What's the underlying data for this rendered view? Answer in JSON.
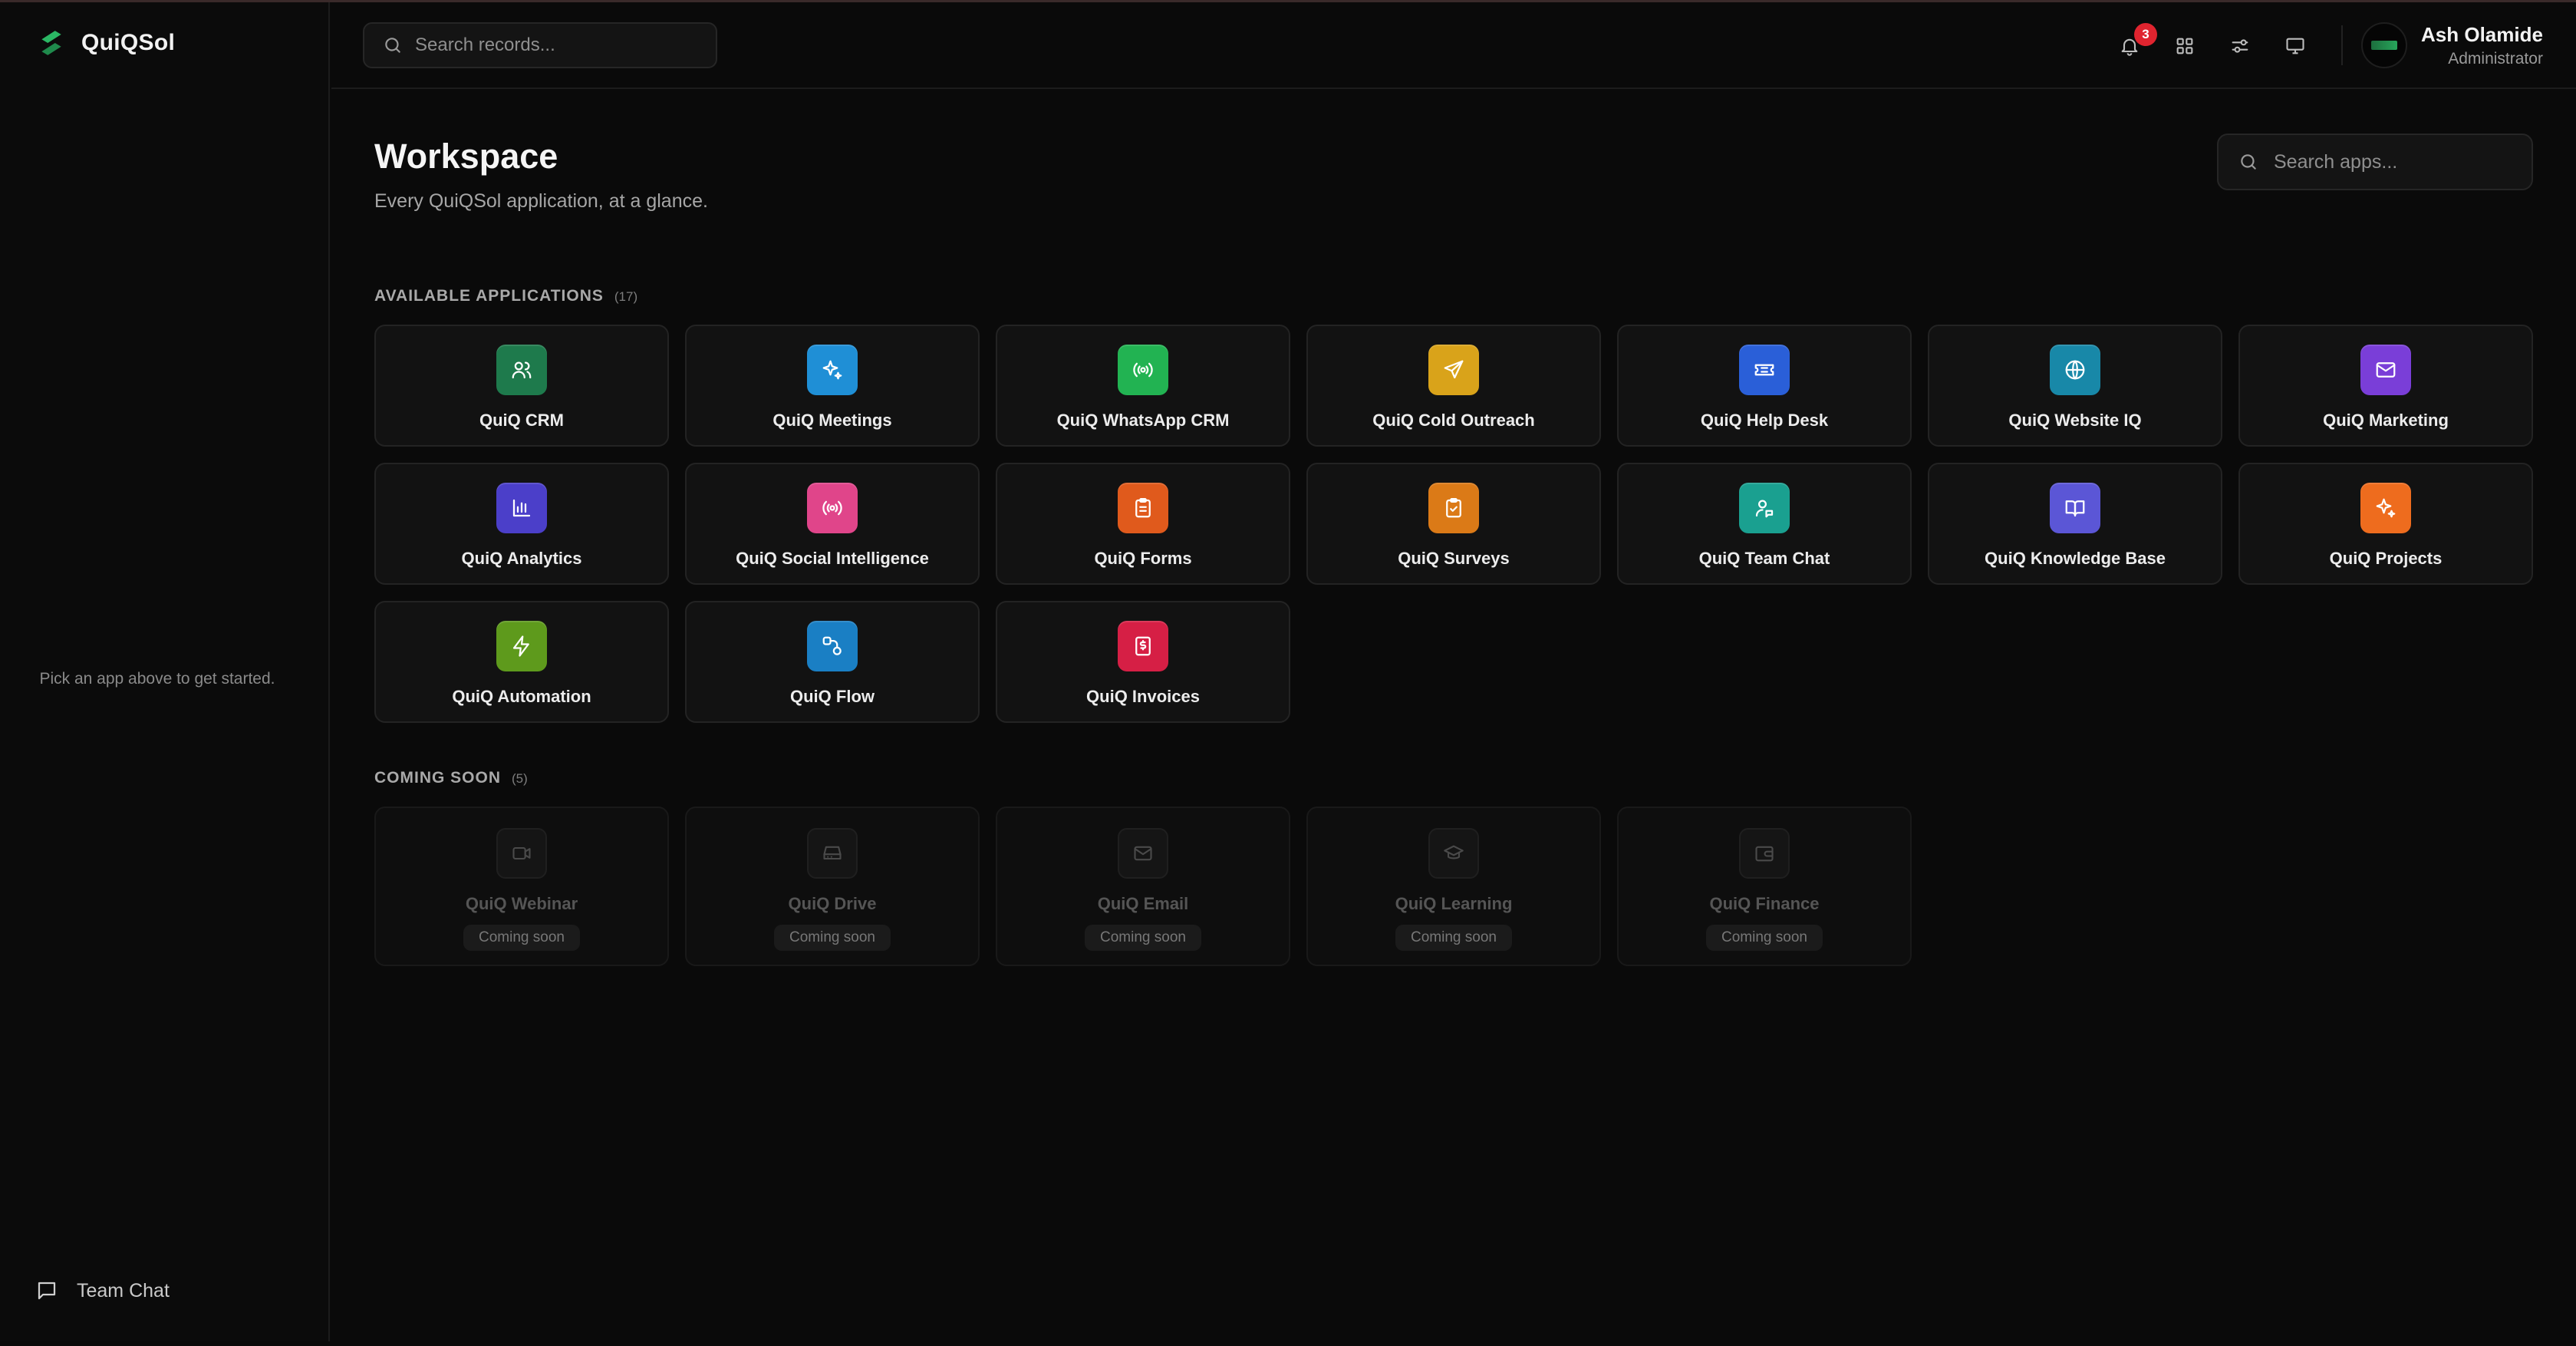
{
  "brand": {
    "name": "QuiQSol",
    "accent": "#2bb764"
  },
  "sidebar": {
    "hint": "Pick an app above to get started.",
    "footer_label": "Team Chat",
    "footer_icon": "message-square-icon"
  },
  "topbar": {
    "search_placeholder": "Search records...",
    "notifications_count": "3",
    "user_name": "Ash Olamide",
    "user_role": "Administrator"
  },
  "main": {
    "title": "Workspace",
    "subtitle": "Every QuiQSol application, at a glance.",
    "search_placeholder": "Search apps...",
    "available": {
      "title": "AVAILABLE APPLICATIONS",
      "count": "(17)",
      "apps": [
        {
          "label": "QuiQ CRM",
          "icon": "users-icon",
          "color": "#1e7a4c"
        },
        {
          "label": "QuiQ Meetings",
          "icon": "sparkles-icon",
          "color": "#1f8fd6"
        },
        {
          "label": "QuiQ WhatsApp CRM",
          "icon": "broadcast-icon",
          "color": "#22b352"
        },
        {
          "label": "QuiQ Cold Outreach",
          "icon": "send-icon",
          "color": "#d9a31a"
        },
        {
          "label": "QuiQ Help Desk",
          "icon": "ticket-icon",
          "color": "#2a5fd8"
        },
        {
          "label": "QuiQ Website IQ",
          "icon": "globe-icon",
          "color": "#1888a8"
        },
        {
          "label": "QuiQ Marketing",
          "icon": "mail-icon",
          "color": "#7a3ed8"
        },
        {
          "label": "QuiQ Analytics",
          "icon": "bar-chart-icon",
          "color": "#4b3fc9"
        },
        {
          "label": "QuiQ Social Intelligence",
          "icon": "broadcast-icon",
          "color": "#e0458a"
        },
        {
          "label": "QuiQ Forms",
          "icon": "clipboard-icon",
          "color": "#e05a1c"
        },
        {
          "label": "QuiQ Surveys",
          "icon": "clipboard-check-icon",
          "color": "#db7a17"
        },
        {
          "label": "QuiQ Team Chat",
          "icon": "user-chat-icon",
          "color": "#1aa090"
        },
        {
          "label": "QuiQ Knowledge Base",
          "icon": "book-icon",
          "color": "#5b56d6"
        },
        {
          "label": "QuiQ Projects",
          "icon": "sparkles-icon",
          "color": "#ee6c1e"
        },
        {
          "label": "QuiQ Automation",
          "icon": "zap-icon",
          "color": "#5e9a1c"
        },
        {
          "label": "QuiQ Flow",
          "icon": "workflow-icon",
          "color": "#1a7fc4"
        },
        {
          "label": "QuiQ Invoices",
          "icon": "invoice-icon",
          "color": "#d61f45"
        }
      ]
    },
    "coming_soon": {
      "title": "COMING SOON",
      "count": "(5)",
      "pill": "Coming soon",
      "apps": [
        {
          "label": "QuiQ Webinar",
          "icon": "video-icon"
        },
        {
          "label": "QuiQ Drive",
          "icon": "hard-drive-icon"
        },
        {
          "label": "QuiQ Email",
          "icon": "mail-icon"
        },
        {
          "label": "QuiQ Learning",
          "icon": "graduation-cap-icon"
        },
        {
          "label": "QuiQ Finance",
          "icon": "wallet-icon"
        }
      ]
    }
  }
}
